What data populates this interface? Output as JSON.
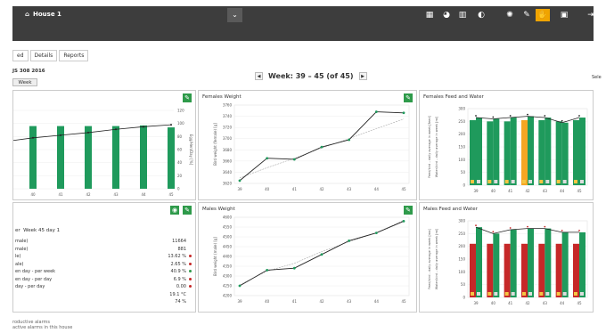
{
  "header": {
    "house": "House 1",
    "dropdown_icon": "chevron-down-icon"
  },
  "toolbar": [
    {
      "name": "grid-icon",
      "glyph": "▦"
    },
    {
      "name": "eggs-icon",
      "glyph": "◕"
    },
    {
      "name": "barn-icon",
      "glyph": "▥"
    },
    {
      "name": "clock-icon",
      "glyph": "◐"
    },
    {
      "name": "sun-icon",
      "glyph": "✺"
    },
    {
      "name": "edit-icon",
      "glyph": "✎"
    },
    {
      "name": "hand-icon",
      "glyph": "✋"
    },
    {
      "name": "screen-icon",
      "glyph": "▣"
    },
    {
      "name": "logout-icon",
      "glyph": "⇥"
    }
  ],
  "tabs": [
    "ed",
    "Details",
    "Reports"
  ],
  "left_info": "JS 308 2016",
  "week_btn": "Week",
  "week_nav": {
    "label": "Week: 39 – 45 (of 45)"
  },
  "select_label": "Sele",
  "p1": {
    "xticks": [
      "40",
      "41",
      "42",
      "43",
      "44",
      "45"
    ],
    "yticks": [
      "120",
      "100",
      "80",
      "60",
      "40",
      "20",
      "0"
    ],
    "ylabel": "Egg/Hen/Day [%]"
  },
  "p2": {
    "title": "Females  Weight",
    "ylabel": "Bird weight (female) [g]",
    "yticks": [
      "3760",
      "3740",
      "3720",
      "3700",
      "3680",
      "3660",
      "3640",
      "3620"
    ],
    "xticks": [
      "39",
      "40",
      "41",
      "42",
      "43",
      "44",
      "45"
    ]
  },
  "p3": {
    "title": "Females  Feed and Water",
    "ylabel": "Feed/bird - daily average in week [feed]",
    "ylabel2": "Water/bird - daily average in week [ml]",
    "yticks": [
      "300",
      "250",
      "200",
      "150",
      "100",
      "50",
      "0"
    ],
    "xticks": [
      "39",
      "40",
      "41",
      "42",
      "43",
      "44",
      "45"
    ]
  },
  "p4": {
    "title_pre": "er",
    "title": "Week 45 day 1",
    "stats": [
      {
        "label": "male)",
        "value": "11664",
        "dot": ""
      },
      {
        "label": "male)",
        "value": "881",
        "dot": ""
      },
      {
        "label": "le)",
        "value": "13.62 %",
        "dot": "red"
      },
      {
        "label": "ale)",
        "value": "2.65 %",
        "dot": "red"
      },
      {
        "label": "en day - per week",
        "value": "40.9 %",
        "dot": "green"
      },
      {
        "label": "en day - per day",
        "value": "6.9 %",
        "dot": "red"
      },
      {
        "label": "day - per day",
        "value": "0.00",
        "dot": "red"
      },
      {
        "label": "",
        "value": "19.1 °C",
        "dot": ""
      },
      {
        "label": "",
        "value": "74 %",
        "dot": ""
      }
    ]
  },
  "p5": {
    "title": "Males  Weight",
    "ylabel": "Bird weight (male) [g]",
    "yticks": [
      "4600",
      "4550",
      "4500",
      "4450",
      "4400",
      "4350",
      "4300",
      "4250",
      "4200"
    ],
    "xticks": [
      "39",
      "40",
      "41",
      "42",
      "43",
      "44",
      "45"
    ]
  },
  "p6": {
    "title": "Males  Feed and Water",
    "ylabel": "Feed/bird - daily average in week [ma]",
    "ylabel2": "Water/bird - daily average in week [ml]",
    "yticks": [
      "300",
      "250",
      "200",
      "150",
      "100",
      "50",
      "0"
    ],
    "xticks": [
      "39",
      "40",
      "41",
      "42",
      "43",
      "44",
      "45"
    ]
  },
  "footer": {
    "line1": "roductive alarms",
    "line2": "active alarms in this house"
  },
  "colors": {
    "green": "#1f9a5c",
    "orange": "#f5a623",
    "red": "#c62828",
    "dark": "#3d3d3d"
  },
  "chart_data": [
    {
      "type": "bar",
      "name": "egg production",
      "categories": [
        "40",
        "41",
        "42",
        "43",
        "44",
        "45"
      ],
      "values": [
        96,
        96,
        96,
        96,
        97,
        94
      ],
      "line_values": [
        78,
        82,
        86,
        91,
        95,
        98
      ],
      "ylim": [
        0,
        120
      ]
    },
    {
      "type": "line",
      "name": "Females Weight",
      "x": [
        "39",
        "40",
        "41",
        "42",
        "43",
        "44",
        "45"
      ],
      "values": [
        3625,
        3665,
        3663,
        3685,
        3698,
        3748,
        3746
      ],
      "target": [
        3630,
        3648,
        3665,
        3683,
        3700,
        3718,
        3735
      ],
      "ylim": [
        3620,
        3760
      ]
    },
    {
      "type": "bar",
      "name": "Females Feed and Water",
      "categories": [
        "39",
        "40",
        "41",
        "42",
        "43",
        "44",
        "45"
      ],
      "feed": [
        255,
        250,
        250,
        255,
        255,
        250,
        255
      ],
      "water": [
        265,
        260,
        265,
        270,
        265,
        245,
        265
      ],
      "bar_colors": [
        "green",
        "green",
        "green",
        "orange",
        "green",
        "green",
        "green"
      ],
      "ylim": [
        0,
        300
      ]
    },
    {
      "type": "line",
      "name": "Males Weight",
      "x": [
        "39",
        "40",
        "41",
        "42",
        "43",
        "44",
        "45"
      ],
      "values": [
        4250,
        4330,
        4340,
        4410,
        4480,
        4520,
        4580
      ],
      "target": [
        4255,
        4325,
        4365,
        4425,
        4475,
        4520,
        4585
      ],
      "ylim": [
        4200,
        4600
      ]
    },
    {
      "type": "bar",
      "name": "Males Feed and Water",
      "categories": [
        "39",
        "40",
        "41",
        "42",
        "43",
        "44",
        "45"
      ],
      "feed": [
        210,
        210,
        210,
        210,
        210,
        210,
        210
      ],
      "water": [
        275,
        250,
        265,
        270,
        270,
        255,
        255
      ],
      "ylim": [
        0,
        300
      ]
    }
  ]
}
